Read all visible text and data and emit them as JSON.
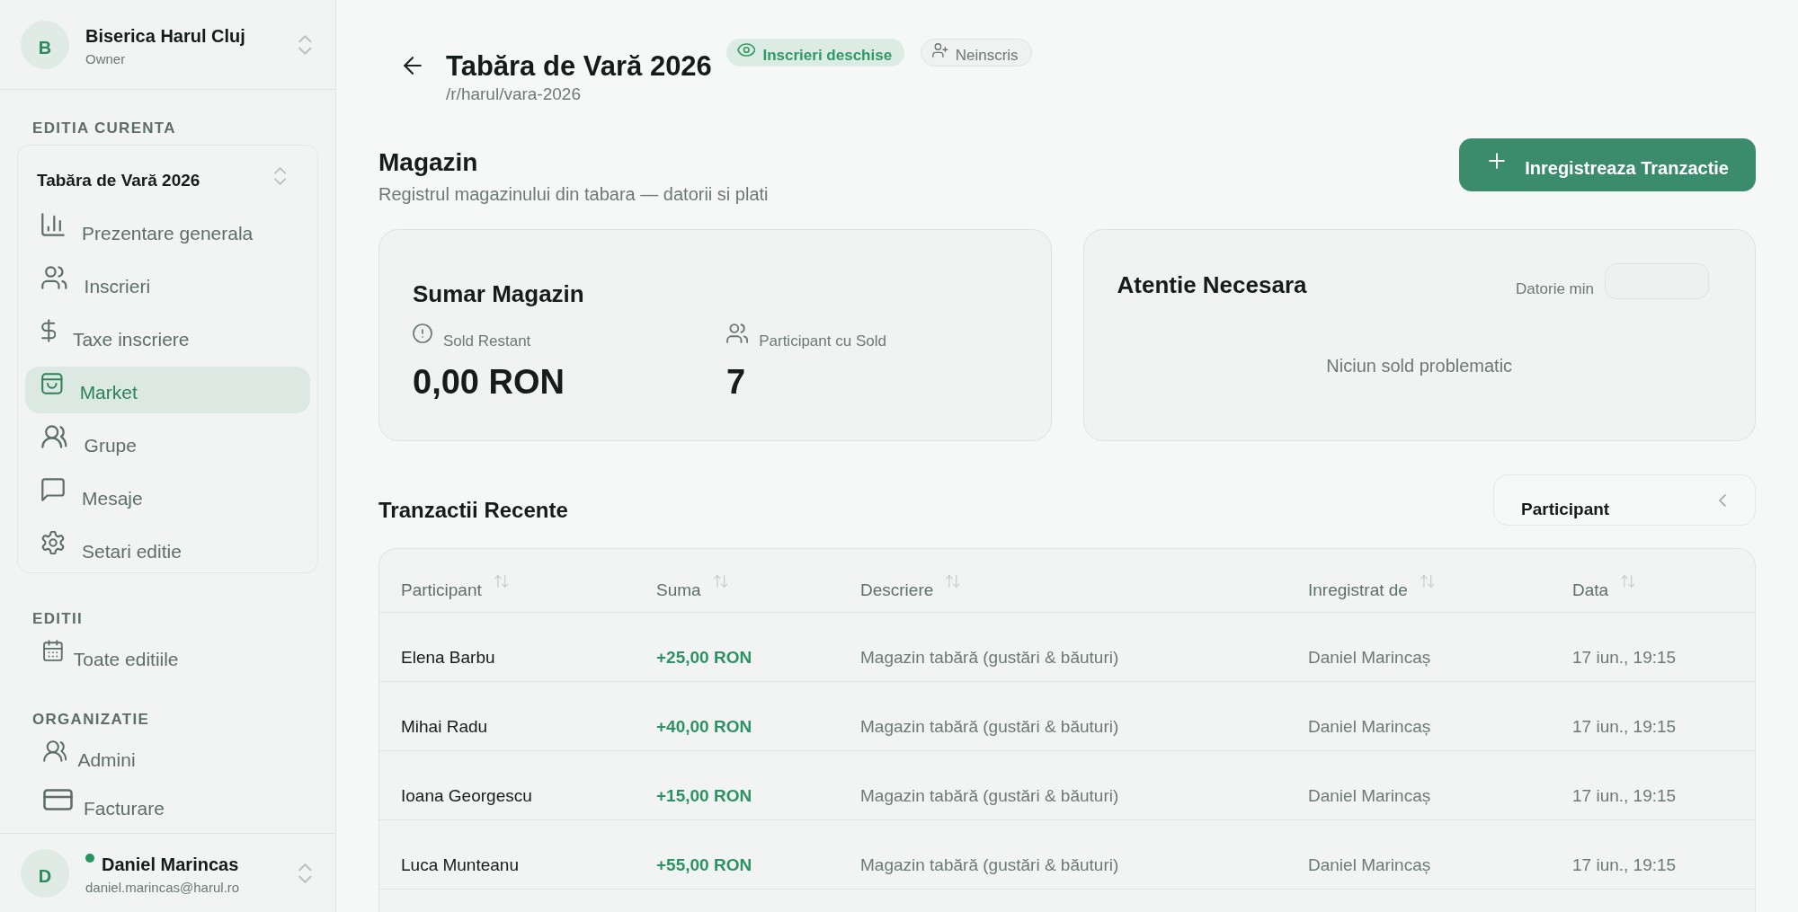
{
  "sidebar": {
    "organization": {
      "initial": "B",
      "name": "Biserica Harul Cluj",
      "role": "Owner"
    },
    "current_edition": {
      "title": "EDITIA CURENTA",
      "selector": "Tabăra de Vară 2026",
      "items": [
        {
          "label": "Prezentare generala",
          "selected": false
        },
        {
          "label": "Inscrieri",
          "selected": false
        },
        {
          "label": "Taxe inscriere",
          "selected": false
        },
        {
          "label": "Market",
          "selected": true
        },
        {
          "label": "Grupe",
          "selected": false
        },
        {
          "label": "Mesaje",
          "selected": false
        },
        {
          "label": "Setari editie",
          "selected": false
        }
      ]
    },
    "sections": [
      {
        "title": "EDITII",
        "items": [
          {
            "label": "Toate editiile",
            "selected": false
          }
        ]
      },
      {
        "title": "ORGANIZATIE",
        "items": [
          {
            "label": "Admini",
            "selected": false
          },
          {
            "label": "Facturare",
            "selected": false
          }
        ]
      }
    ],
    "user": {
      "initial": "D",
      "name": "Daniel Marincas",
      "email": "daniel.marincas@harul.ro",
      "online": true
    }
  },
  "header": {
    "title": "Tabăra de Vară 2026",
    "slug": "/r/harul/vara-2026",
    "badges": [
      {
        "kind": "status",
        "label": "Inscrieri deschise"
      },
      {
        "kind": "registration",
        "label": "Neinscris"
      }
    ]
  },
  "page": {
    "title": "Magazin",
    "subtitle": "Registrul magazinului din tabara — datorii si plati",
    "action": "Inregistreaza Tranzactie"
  },
  "summary": {
    "title": "Sumar Magazin",
    "stats": [
      {
        "label": "Sold Restant",
        "value": "0,00 RON"
      },
      {
        "label": "Participant cu Sold",
        "value": "7"
      }
    ]
  },
  "attention": {
    "title": "Atentie Necesara",
    "filter_label": "Datorie min",
    "empty_message": "Niciun sold problematic"
  },
  "transactions": {
    "title": "Tranzactii Recente",
    "filter": {
      "value": "Participant"
    },
    "columns": [
      "Participant",
      "Suma",
      "Descriere",
      "Inregistrat de",
      "Data"
    ],
    "rows": [
      {
        "participant": "Elena Barbu",
        "amount": "+25,00 RON",
        "description": "Magazin tabără (gustări & băuturi)",
        "recorded_by": "Daniel Marincaș",
        "date": "17 iun., 19:15"
      },
      {
        "participant": "Mihai Radu",
        "amount": "+40,00 RON",
        "description": "Magazin tabără (gustări & băuturi)",
        "recorded_by": "Daniel Marincaș",
        "date": "17 iun., 19:15"
      },
      {
        "participant": "Ioana Georgescu",
        "amount": "+15,00 RON",
        "description": "Magazin tabără (gustări & băuturi)",
        "recorded_by": "Daniel Marincaș",
        "date": "17 iun., 19:15"
      },
      {
        "participant": "Luca Munteanu",
        "amount": "+55,00 RON",
        "description": "Magazin tabără (gustări & băuturi)",
        "recorded_by": "Daniel Marincaș",
        "date": "17 iun., 19:15"
      }
    ]
  }
}
